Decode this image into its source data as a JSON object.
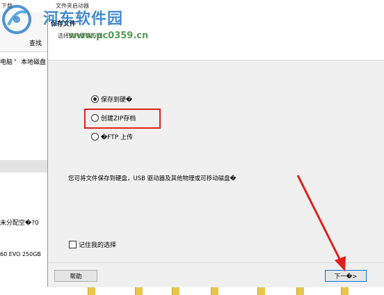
{
  "background_window": {
    "title_left": "下载",
    "title_right": "文件夹启动器",
    "ribbon_item": "查找",
    "address_parts": [
      "电脑",
      "本地磁盘"
    ],
    "left_line1": "未分配空�?0",
    "left_line2": "60 EVO 250GB"
  },
  "watermark": {
    "title": "河东软件园",
    "url": "www.pc0359.cn"
  },
  "dialog": {
    "title": "保存文件",
    "subtitle": "选择文件保存方式",
    "options": [
      {
        "label": "保存到硬�",
        "checked": true
      },
      {
        "label": "创建ZIP存档",
        "checked": false
      },
      {
        "label": "�FTP 上传",
        "checked": false
      }
    ],
    "description": "您可将文件保存到硬盘，USB 驱动器及其他物理或可移动磁盘�",
    "remember_label": "记住我的选择",
    "remember_checked": false,
    "help_label": "帮助",
    "next_label": "下一�>"
  },
  "colors": {
    "highlight": "#e02020",
    "arrow": "#e02020",
    "watermark_blue": "#2478c6",
    "watermark_green": "#3a8a3a"
  }
}
